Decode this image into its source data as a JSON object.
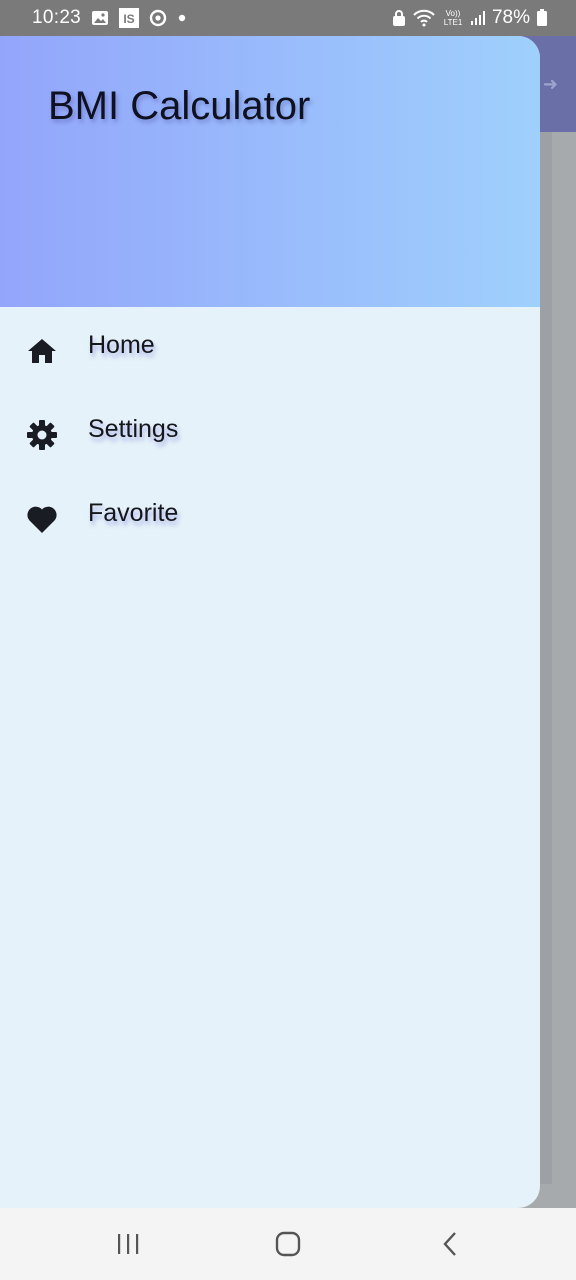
{
  "status_bar": {
    "time": "10:23",
    "battery": "78%",
    "icons": [
      "gallery-icon",
      "is-app-icon",
      "sync-icon",
      "notification-dot-icon",
      "lock-icon",
      "wifi-icon",
      "volte-icon",
      "signal-icon",
      "battery-icon"
    ]
  },
  "drawer": {
    "title": "BMI Calculator",
    "header_gradient": [
      "#93a5fb",
      "#9fd0fc"
    ],
    "background": "#e6f2f9",
    "items": [
      {
        "label": "Home",
        "icon": "home-icon"
      },
      {
        "label": "Settings",
        "icon": "settings-gear-icon"
      },
      {
        "label": "Favorite",
        "icon": "heart-icon"
      }
    ]
  },
  "nav_bar": {
    "buttons": [
      "recent-apps-icon",
      "home-button-icon",
      "back-icon"
    ]
  }
}
